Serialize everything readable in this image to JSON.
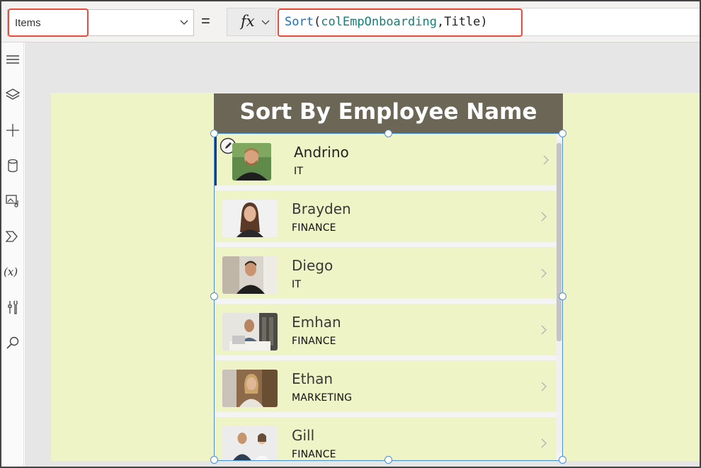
{
  "formula_bar": {
    "property": "Items",
    "equals": "=",
    "fx_label": "fx",
    "formula": {
      "fn": "Sort",
      "open": "(",
      "collection": "colEmpOnboarding",
      "comma": ",",
      "field": "Title",
      "close": ")"
    }
  },
  "left_rail": {
    "icons": [
      "hamburger-menu-icon",
      "layers-icon",
      "plus-icon",
      "database-icon",
      "media-icon",
      "power-automate-icon",
      "variables-icon",
      "tools-icon",
      "search-icon"
    ],
    "variables_glyph": "(x)"
  },
  "screen": {
    "title": "Sort By Employee Name",
    "background": "#eef4c5",
    "header_color": "#6b6656"
  },
  "gallery": {
    "items": [
      {
        "name": "Andrino",
        "dept": "IT"
      },
      {
        "name": "Brayden",
        "dept": "FINANCE"
      },
      {
        "name": "Diego",
        "dept": "IT"
      },
      {
        "name": "Emhan",
        "dept": "FINANCE"
      },
      {
        "name": "Ethan",
        "dept": "MARKETING"
      },
      {
        "name": "Gill",
        "dept": "FINANCE"
      }
    ]
  }
}
